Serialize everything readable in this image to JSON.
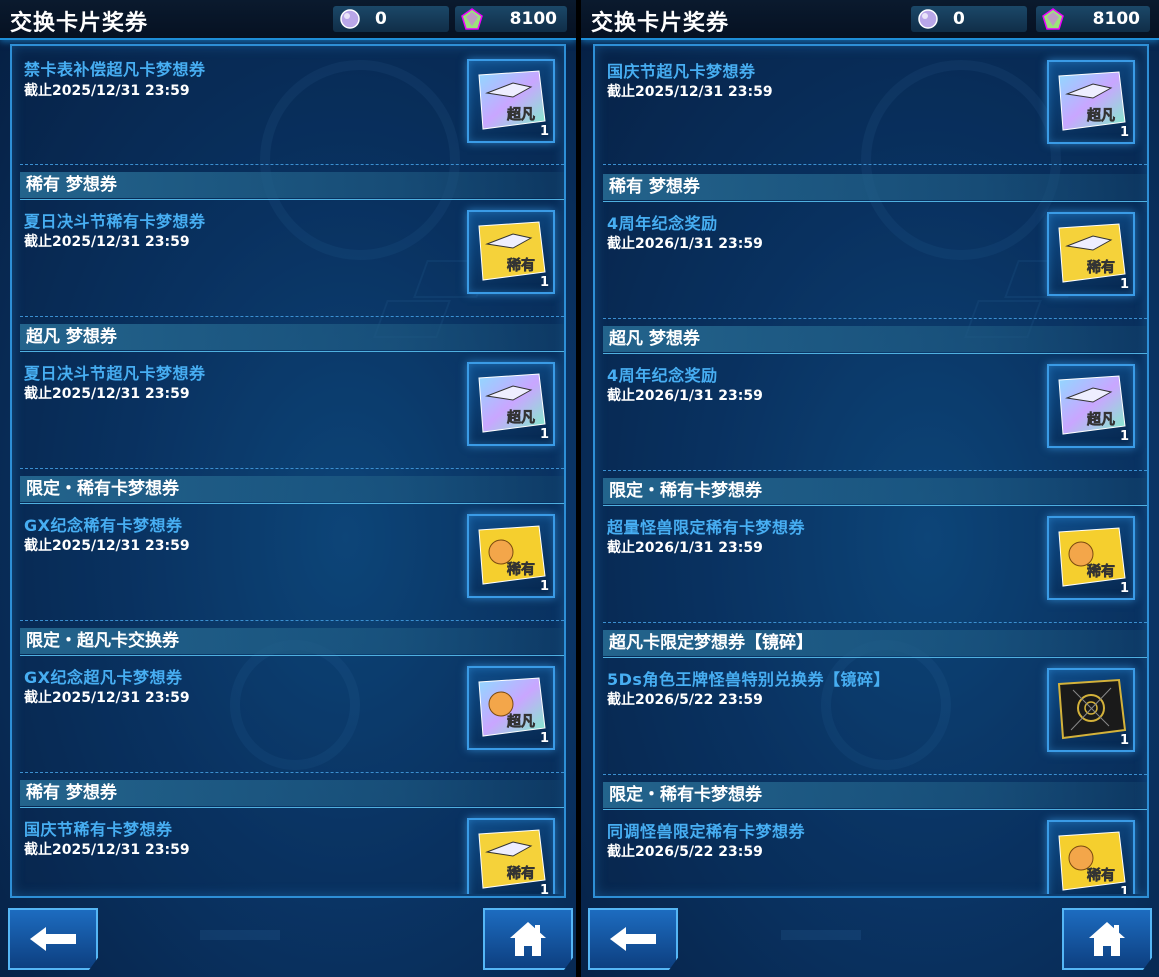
{
  "panels": [
    {
      "title": "交换卡片奖券",
      "currency1": "0",
      "currency2": "8100",
      "first_item": {
        "name": "禁卡表补偿超凡卡梦想券",
        "date": "截止2025/12/31 23:59",
        "ticket_label": "超凡",
        "qty": "1"
      },
      "sections": [
        {
          "header": "稀有 梦想券",
          "name": "夏日决斗节稀有卡梦想券",
          "date": "截止2025/12/31 23:59",
          "ticket_label": "稀有",
          "qty": "1"
        },
        {
          "header": "超凡 梦想券",
          "name": "夏日决斗节超凡卡梦想券",
          "date": "截止2025/12/31 23:59",
          "ticket_label": "超凡",
          "qty": "1"
        },
        {
          "header": "限定・稀有卡梦想券",
          "name": "GX纪念稀有卡梦想券",
          "date": "截止2025/12/31 23:59",
          "ticket_label": "稀有",
          "qty": "1"
        },
        {
          "header": "限定・超凡卡交换券",
          "name": "GX纪念超凡卡梦想券",
          "date": "截止2025/12/31 23:59",
          "ticket_label": "超凡",
          "qty": "1"
        },
        {
          "header": "稀有 梦想券",
          "name": "国庆节稀有卡梦想券",
          "date": "截止2025/12/31 23:59",
          "ticket_label": "稀有",
          "qty": "1"
        }
      ]
    },
    {
      "title": "交换卡片奖券",
      "currency1": "0",
      "currency2": "8100",
      "first_item": {
        "name": "国庆节超凡卡梦想券",
        "date": "截止2025/12/31 23:59",
        "ticket_label": "超凡",
        "qty": "1"
      },
      "sections": [
        {
          "header": "稀有 梦想券",
          "name": "4周年纪念奖励",
          "date": "截止2026/1/31 23:59",
          "ticket_label": "稀有",
          "qty": "1"
        },
        {
          "header": "超凡 梦想券",
          "name": "4周年纪念奖励",
          "date": "截止2026/1/31 23:59",
          "ticket_label": "超凡",
          "qty": "1"
        },
        {
          "header": "限定・稀有卡梦想券",
          "name": "超量怪兽限定稀有卡梦想券",
          "date": "截止2026/1/31 23:59",
          "ticket_label": "稀有",
          "qty": "1"
        },
        {
          "header": "超凡卡限定梦想券【镜碎】",
          "name": "5Ds角色王牌怪兽特别兑换券【镜碎】",
          "date": "截止2026/5/22 23:59",
          "ticket_label": "",
          "qty": "1"
        },
        {
          "header": "限定・稀有卡梦想券",
          "name": "同调怪兽限定稀有卡梦想券",
          "date": "截止2026/5/22 23:59",
          "ticket_label": "稀有",
          "qty": "1"
        }
      ]
    }
  ]
}
